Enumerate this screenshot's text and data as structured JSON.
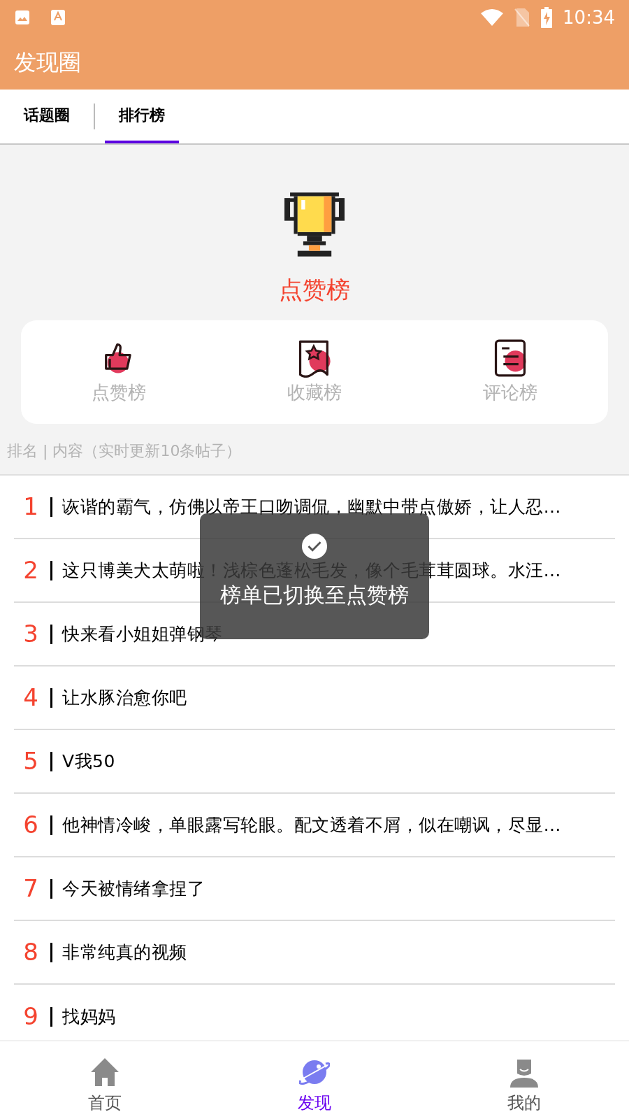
{
  "status_bar": {
    "time": "10:34"
  },
  "app_bar": {
    "title": "发现圈"
  },
  "tabs": [
    {
      "label": "话题圈",
      "selected": false
    },
    {
      "label": "排行榜",
      "selected": true
    }
  ],
  "board": {
    "title": "点赞榜"
  },
  "board_options": [
    {
      "kind": "like",
      "label": "点赞榜"
    },
    {
      "kind": "favorite",
      "label": "收藏榜"
    },
    {
      "kind": "comment",
      "label": "评论榜"
    }
  ],
  "list_caption": "排名 | 内容（实时更新10条帖子）",
  "rows": [
    {
      "rank": "1",
      "text": "诙谐的霸气，仿佛以帝王口吻调侃，幽默中带点傲娇，让人忍…"
    },
    {
      "rank": "2",
      "text": "这只博美犬太萌啦！浅棕色蓬松毛发，像个毛茸茸圆球。水汪…"
    },
    {
      "rank": "3",
      "text": "快来看小姐姐弹钢琴"
    },
    {
      "rank": "4",
      "text": "让水豚治愈你吧"
    },
    {
      "rank": "5",
      "text": "V我50"
    },
    {
      "rank": "6",
      "text": "他神情冷峻，单眼露写轮眼。配文透着不屑，似在嘲讽，尽显…"
    },
    {
      "rank": "7",
      "text": "今天被情绪拿捏了"
    },
    {
      "rank": "8",
      "text": "非常纯真的视频"
    },
    {
      "rank": "9",
      "text": "找妈妈"
    }
  ],
  "toast": {
    "message": "榜单已切换至点赞榜"
  },
  "bottom_nav": [
    {
      "kind": "home",
      "label": "首页",
      "selected": false
    },
    {
      "kind": "discover",
      "label": "发现",
      "selected": true
    },
    {
      "kind": "me",
      "label": "我的",
      "selected": false
    }
  ]
}
